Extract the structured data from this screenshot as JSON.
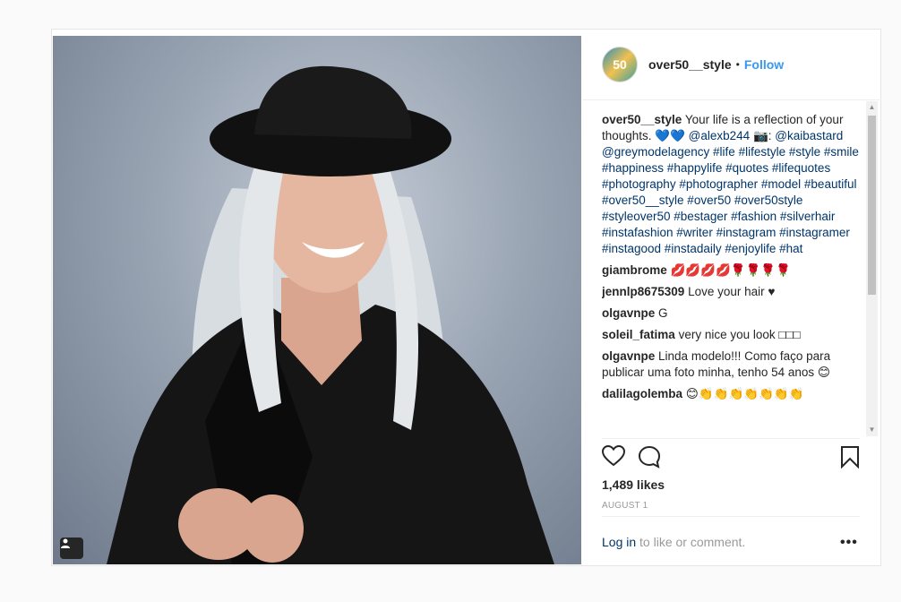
{
  "post": {
    "username": "over50__style",
    "avatar_text": "50",
    "separator": "•",
    "follow_label": "Follow"
  },
  "caption": {
    "username": "over50__style",
    "text_start": "Your life is a reflection of your thoughts. 💙💙 ",
    "mention_1": "@alexb244",
    "camera": " 📷: ",
    "mention_2": "@kaibastard",
    "mention_3": "@greymodelagency",
    "hashtags": "#life #lifestyle #style #smile #happiness #happylife #quotes #lifequotes #photography #photographer #model #beautiful #over50__style #over50 #over50style #styleover50 #bestager #fashion #silverhair #instafashion #writer #instagram #instagramer #instagood #instadaily #enjoylife #hat"
  },
  "comments": [
    {
      "user": "giambrome",
      "text": "💋💋💋💋🌹🌹🌹🌹"
    },
    {
      "user": "jennlp8675309",
      "text": "Love your hair ♥"
    },
    {
      "user": "olgavnpe",
      "text": "G"
    },
    {
      "user": "soleil_fatima",
      "text": "very nice you look □□□"
    },
    {
      "user": "olgavnpe",
      "text": "Linda modelo!!! Como faço para publicar uma foto minha, tenho 54 anos 😊"
    },
    {
      "user": "dalilagolemba",
      "text": "😊👏👏👏👏👏👏👏"
    }
  ],
  "stats": {
    "likes": "1,489 likes",
    "date": "AUGUST 1"
  },
  "footer": {
    "login_link": "Log in",
    "login_rest": " to like or comment.",
    "more": "•••"
  },
  "icons": {
    "like": "heart-icon",
    "comment": "comment-icon",
    "save": "bookmark-icon",
    "tagged": "user-tag-icon"
  },
  "colors": {
    "link": "#003569",
    "follow": "#3897f0"
  }
}
